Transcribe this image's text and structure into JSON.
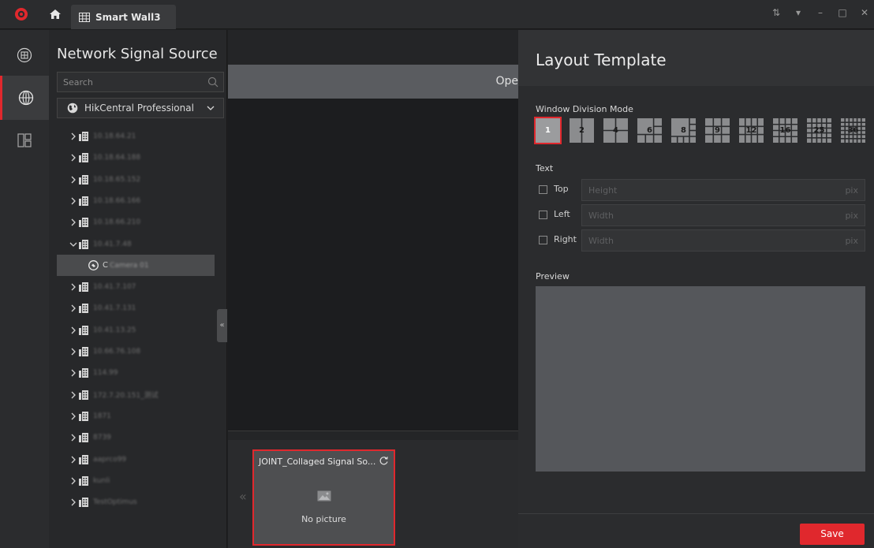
{
  "topbar": {
    "tab_label": "Smart Wall3",
    "window_controls": [
      "⇅",
      "▾",
      "–",
      "□",
      "✕"
    ]
  },
  "rail": {
    "items": [
      {
        "icon": "access-icon",
        "active": false
      },
      {
        "icon": "network-globe-icon",
        "active": true
      },
      {
        "icon": "layout-icon",
        "active": false
      }
    ]
  },
  "tree": {
    "title": "Network Signal Source",
    "search_placeholder": "Search",
    "dropdown_value": "HikCentral Professional",
    "items": [
      {
        "label": "10.18.64.21",
        "expanded": false
      },
      {
        "label": "10.18.64.188",
        "expanded": false
      },
      {
        "label": "10.18.65.152",
        "expanded": false
      },
      {
        "label": "10.18.66.166",
        "expanded": false
      },
      {
        "label": "10.18.66.210",
        "expanded": false
      },
      {
        "label": "10.41.7.48",
        "expanded": true
      },
      {
        "label": "Camera 01",
        "selected": true,
        "child": true
      },
      {
        "label": "10.41.7.107",
        "expanded": false
      },
      {
        "label": "10.41.7.131",
        "expanded": false
      },
      {
        "label": "10.41.13.25",
        "expanded": false
      },
      {
        "label": "10.66.76.108",
        "expanded": false
      },
      {
        "label": "114.99",
        "expanded": false
      },
      {
        "label": "172.7.20.151_测试",
        "expanded": false
      },
      {
        "label": "1871",
        "expanded": false
      },
      {
        "label": "8739",
        "expanded": false
      },
      {
        "label": "aaprco99",
        "expanded": false
      },
      {
        "label": "kunli",
        "expanded": false
      },
      {
        "label": "TestOptimus",
        "expanded": false
      }
    ]
  },
  "center": {
    "header_text": "Ope",
    "source_card": {
      "title": "JOINT_Collaged Signal So...",
      "no_picture": "No picture"
    }
  },
  "layout_template": {
    "title": "Layout Template",
    "window_division_label": "Window Division Mode",
    "modes": [
      "1",
      "2",
      "4",
      "6",
      "8",
      "9",
      "12",
      "16",
      "25",
      "36"
    ],
    "selected_mode": "1",
    "text_label": "Text",
    "text_rows": [
      {
        "label": "Top",
        "placeholder": "Height",
        "unit": "pix"
      },
      {
        "label": "Left",
        "placeholder": "Width",
        "unit": "pix"
      },
      {
        "label": "Right",
        "placeholder": "Width",
        "unit": "pix"
      }
    ],
    "preview_label": "Preview",
    "save_label": "Save"
  },
  "colors": {
    "accent": "#e0282d",
    "background": "#1e1f21",
    "panel": "#2b2c2e"
  }
}
